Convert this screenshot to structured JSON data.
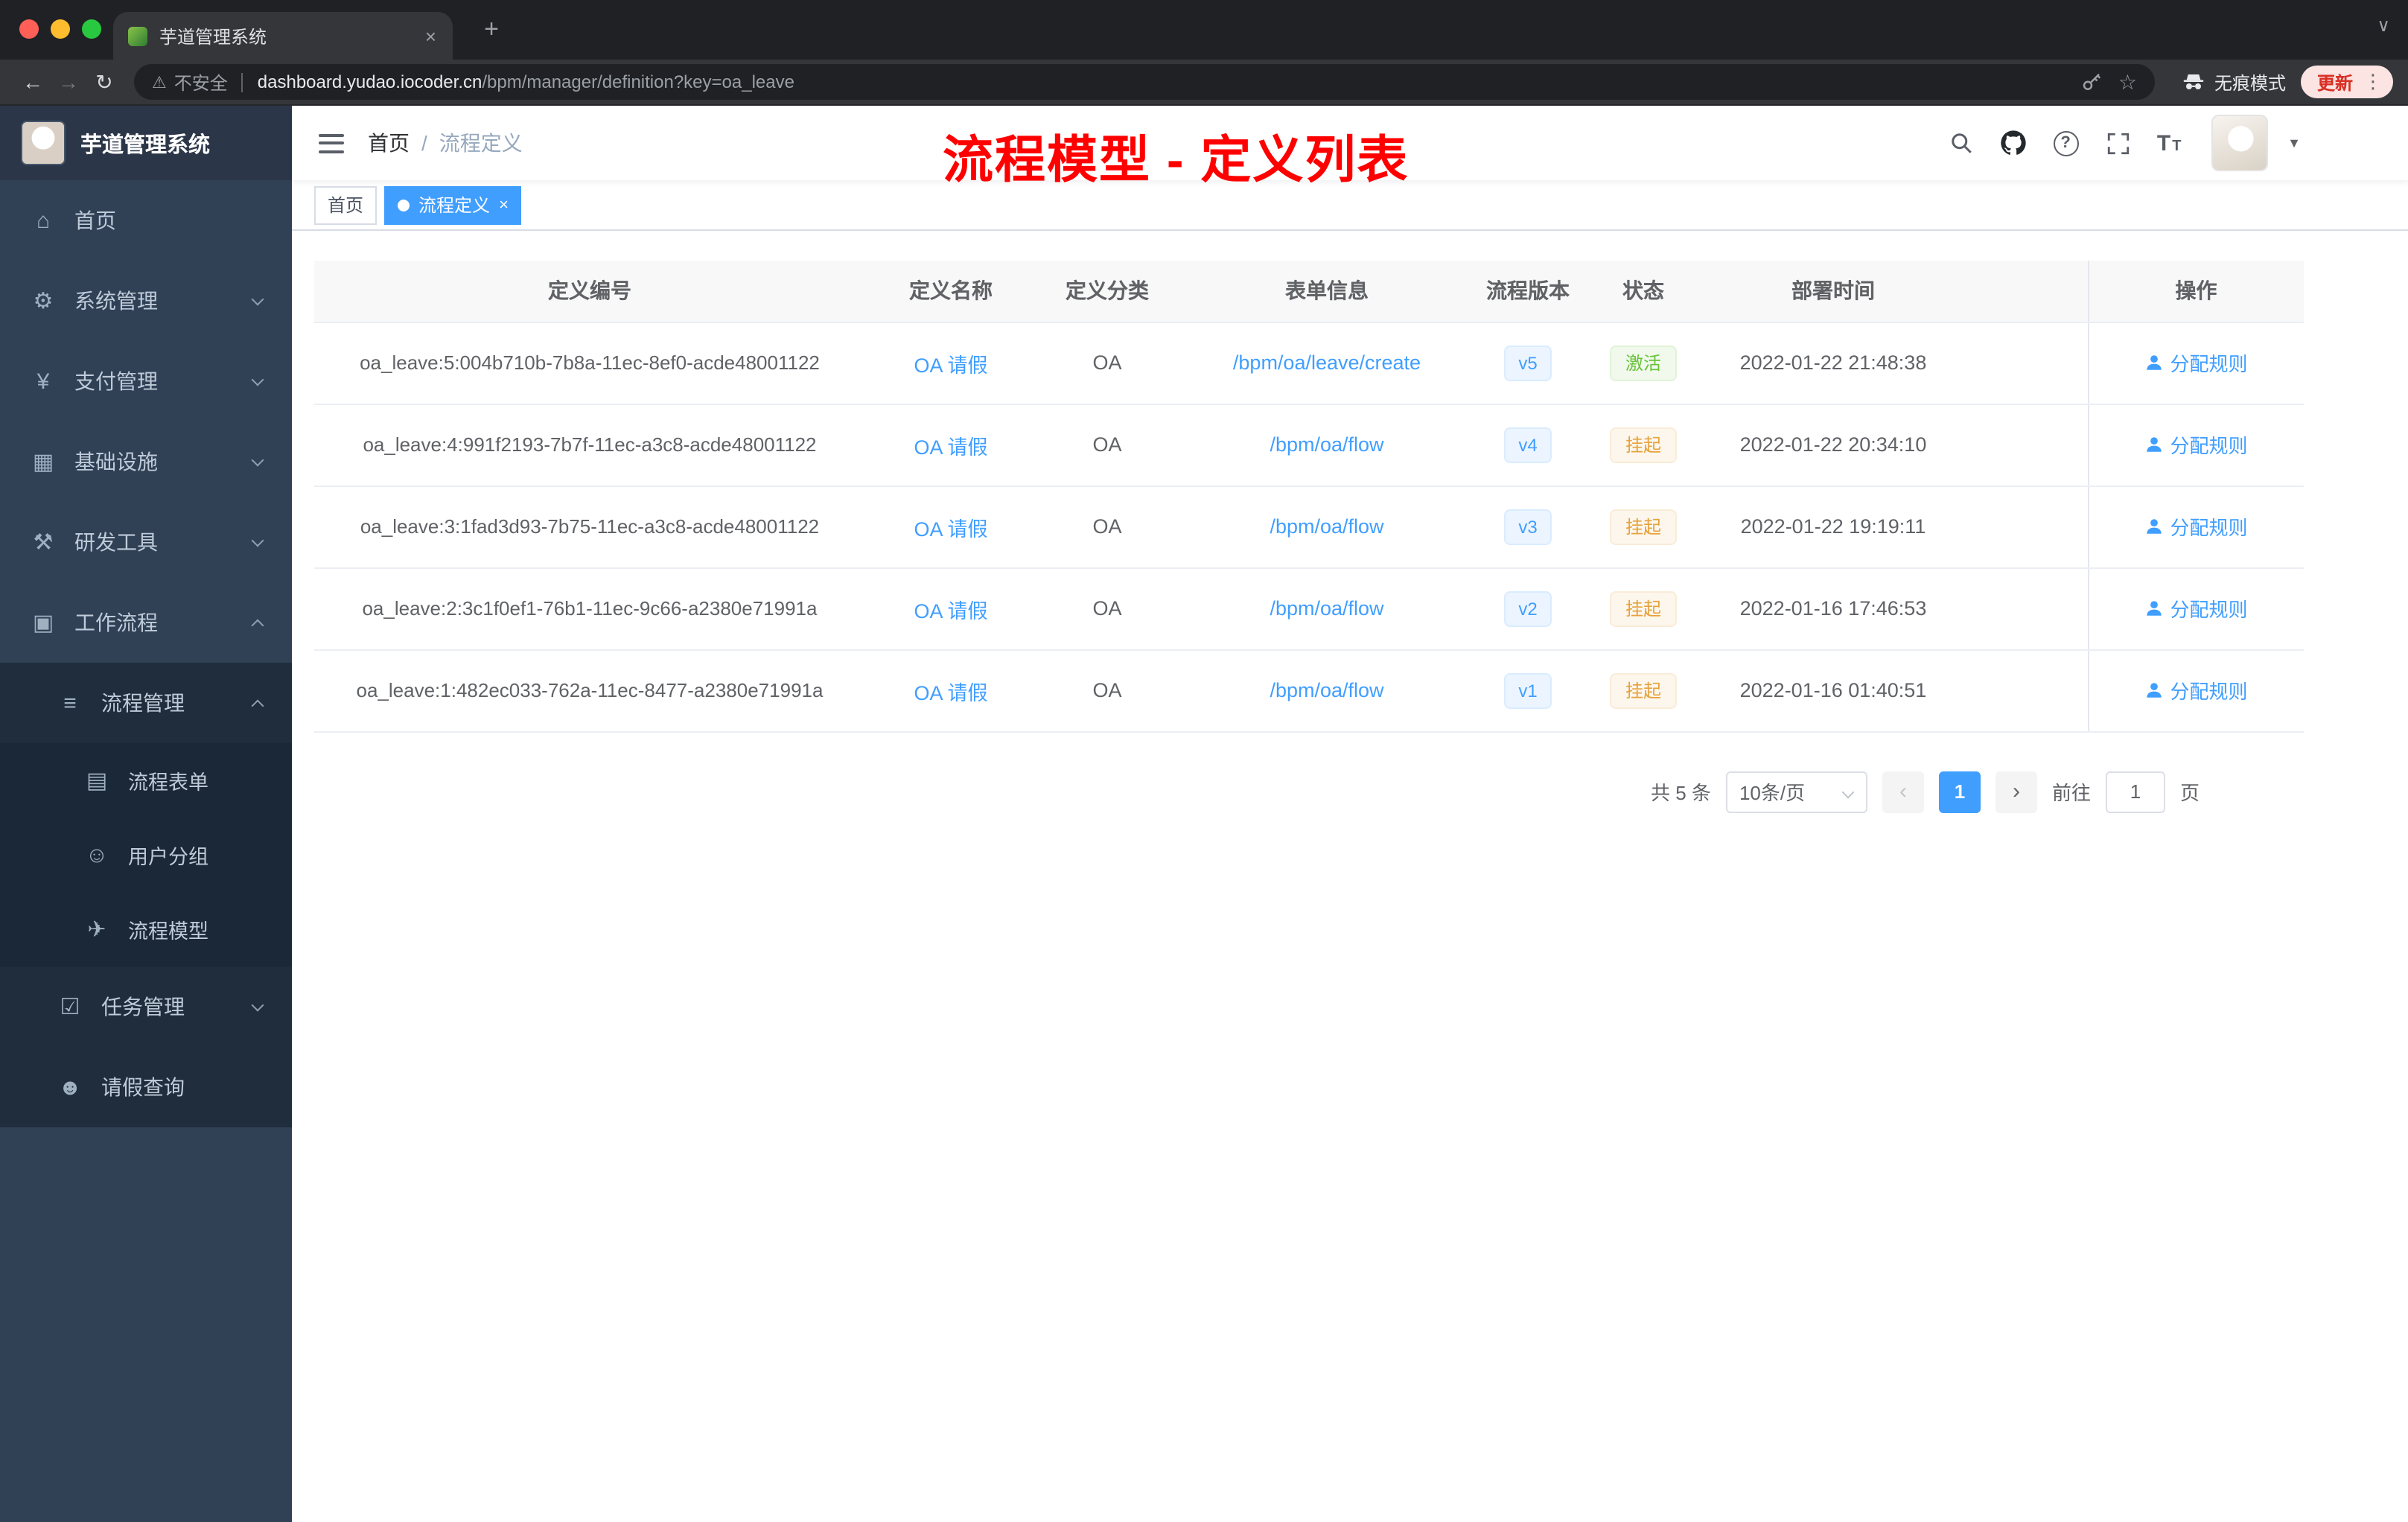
{
  "browser": {
    "tab_title": "芋道管理系统",
    "tab_close": "×",
    "new_tab": "+",
    "tab_search": "∨",
    "back": "←",
    "forward": "→",
    "reload": "↻",
    "warning": "⚠",
    "not_secure": "不安全",
    "url_host": "dashboard.yudao.iocoder.cn",
    "url_path": "/bpm/manager/definition?key=oa_leave",
    "star": "☆",
    "incognito_label": "无痕模式",
    "update_label": "更新",
    "menu_dots": "⋮"
  },
  "sidebar": {
    "logo_title": "芋道管理系统",
    "items": [
      {
        "label": "首页",
        "glyph": "⌂"
      },
      {
        "label": "系统管理",
        "glyph": "⚙"
      },
      {
        "label": "支付管理",
        "glyph": "¥"
      },
      {
        "label": "基础设施",
        "glyph": "▦"
      },
      {
        "label": "研发工具",
        "glyph": "⚒"
      },
      {
        "label": "工作流程",
        "glyph": "▣"
      },
      {
        "label": "流程管理",
        "glyph": "≡"
      },
      {
        "label": "流程表单",
        "glyph": "▤"
      },
      {
        "label": "用户分组",
        "glyph": "☺"
      },
      {
        "label": "流程模型",
        "glyph": "✈"
      },
      {
        "label": "任务管理",
        "glyph": "☑"
      },
      {
        "label": "请假查询",
        "glyph": "☻"
      }
    ]
  },
  "header": {
    "breadcrumb_home": "首页",
    "breadcrumb_sep": "/",
    "breadcrumb_current": "流程定义",
    "annotation": "流程模型 - 定义列表"
  },
  "tags": {
    "home": "首页",
    "active": "流程定义",
    "active_close": "×"
  },
  "table": {
    "columns": [
      "定义编号",
      "定义名称",
      "定义分类",
      "表单信息",
      "流程版本",
      "状态",
      "部署时间",
      "操作"
    ],
    "rows": [
      {
        "id": "oa_leave:5:004b710b-7b8a-11ec-8ef0-acde48001122",
        "name": "OA 请假",
        "category": "OA",
        "form": "/bpm/oa/leave/create",
        "version": "v5",
        "status": "激活",
        "time": "2022-01-22 21:48:38",
        "action": "分配规则"
      },
      {
        "id": "oa_leave:4:991f2193-7b7f-11ec-a3c8-acde48001122",
        "name": "OA 请假",
        "category": "OA",
        "form": "/bpm/oa/flow",
        "version": "v4",
        "status": "挂起",
        "time": "2022-01-22 20:34:10",
        "action": "分配规则"
      },
      {
        "id": "oa_leave:3:1fad3d93-7b75-11ec-a3c8-acde48001122",
        "name": "OA 请假",
        "category": "OA",
        "form": "/bpm/oa/flow",
        "version": "v3",
        "status": "挂起",
        "time": "2022-01-22 19:19:11",
        "action": "分配规则"
      },
      {
        "id": "oa_leave:2:3c1f0ef1-76b1-11ec-9c66-a2380e71991a",
        "name": "OA 请假",
        "category": "OA",
        "form": "/bpm/oa/flow",
        "version": "v2",
        "status": "挂起",
        "time": "2022-01-16 17:46:53",
        "action": "分配规则"
      },
      {
        "id": "oa_leave:1:482ec033-762a-11ec-8477-a2380e71991a",
        "name": "OA 请假",
        "category": "OA",
        "form": "/bpm/oa/flow",
        "version": "v1",
        "status": "挂起",
        "time": "2022-01-16 01:40:51",
        "action": "分配规则"
      }
    ]
  },
  "pagination": {
    "total": "共 5 条",
    "page_size": "10条/页",
    "prev": "‹",
    "current": "1",
    "next": "›",
    "goto": "前往",
    "goto_value": "1",
    "page_unit": "页"
  },
  "colors": {
    "accent": "#409eff",
    "success": "#67c23a",
    "warning": "#e6a23c",
    "annotation": "#ff0000",
    "sidebar_bg": "#304156",
    "sidebar_sub_bg": "#1f2d3d"
  }
}
